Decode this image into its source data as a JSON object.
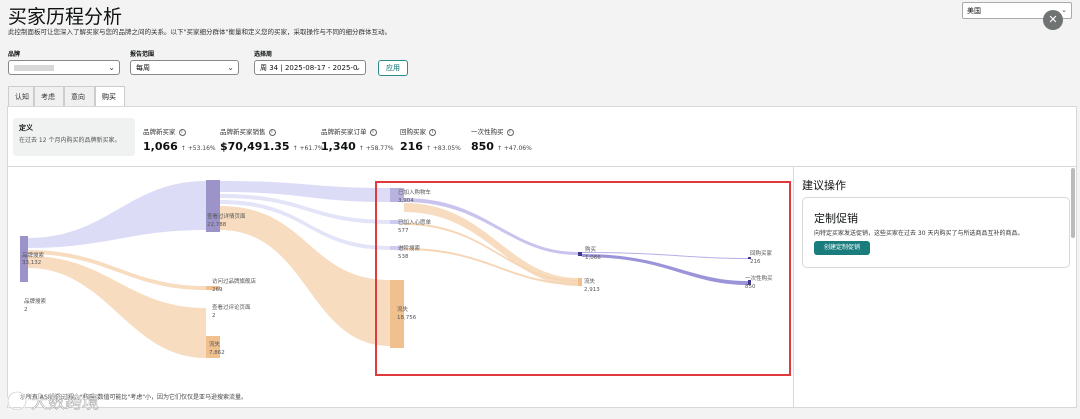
{
  "page": {
    "title": "买家历程分析",
    "subtitle": "此控制面板可让您深入了解买家与您的品牌之间的关系。以下\"买家细分群体\"衡量和定义您的买家，采取操作与不同的细分群体互动。",
    "marketplace": "美国",
    "close_glyph": "✕"
  },
  "filters": {
    "brand_label": "品牌",
    "brand_value": "",
    "range_label": "报告范围",
    "range_value": "每周",
    "week_label": "选择周",
    "week_value": "周 34 | 2025-08-17 - 2025-0",
    "apply_label": "应用"
  },
  "tabs": [
    {
      "label": "认知",
      "active": false
    },
    {
      "label": "考虑",
      "active": false
    },
    {
      "label": "意向",
      "active": false
    },
    {
      "label": "购买",
      "active": true
    }
  ],
  "definition": {
    "title": "定义",
    "text": "在过去 12 个月内购买的品牌新买家。"
  },
  "metrics": [
    {
      "label": "品牌新买家",
      "value": "1,066",
      "change": "↑ +53.16%"
    },
    {
      "label": "品牌新买家销售",
      "value": "$70,491.35",
      "change": "↑ +61.7%"
    },
    {
      "label": "品牌新买家订单",
      "value": "1,340",
      "change": "↑ +58.77%"
    },
    {
      "label": "回购买家",
      "value": "216",
      "change": "↑ +83.05%"
    },
    {
      "label": "一次性购买",
      "value": "850",
      "change": "↑ +47.06%"
    }
  ],
  "sankey": {
    "nodes": [
      {
        "label": "品牌搜索",
        "value": "33,132"
      },
      {
        "label": "品牌搜索",
        "value": "2"
      },
      {
        "label": "查看过详情页面",
        "value": "22,788"
      },
      {
        "label": "访问过品牌旗舰店",
        "value": "269"
      },
      {
        "label": "查看过评论页面",
        "value": "2"
      },
      {
        "label": "流失",
        "value": "7,862"
      },
      {
        "label": "已加入购物车",
        "value": "3,904"
      },
      {
        "label": "已加入心愿单",
        "value": "577"
      },
      {
        "label": "进阶搜索",
        "value": "538"
      },
      {
        "label": "流失",
        "value": "18,756"
      },
      {
        "label": "购买",
        "value": "1,066"
      },
      {
        "label": "流失",
        "value": "2,913"
      },
      {
        "label": "回购买家",
        "value": "216"
      },
      {
        "label": "一次性购买",
        "value": "850"
      }
    ]
  },
  "recommendations": {
    "title": "建议操作",
    "card_title": "定制促销",
    "card_text": "向特定买家发送促销，这些买家在过去 30 天内购买了与所选商品互补的商品。",
    "button_label": "创建定制促销"
  },
  "footnote": "示所有 ASIN 的过程。\"拓展\"数值可能比\"考虑\"小，因为它们仅仅是亚马逊搜索流量。",
  "watermark": "大数跨境",
  "colors": {
    "accent": "#1a7c7d",
    "highlight": "#e0393e",
    "flow_purple": "#dcdcf6",
    "flow_orange": "#f8dcc0",
    "node_purple": "#9c94c8",
    "node_orange": "#f0c08e"
  }
}
